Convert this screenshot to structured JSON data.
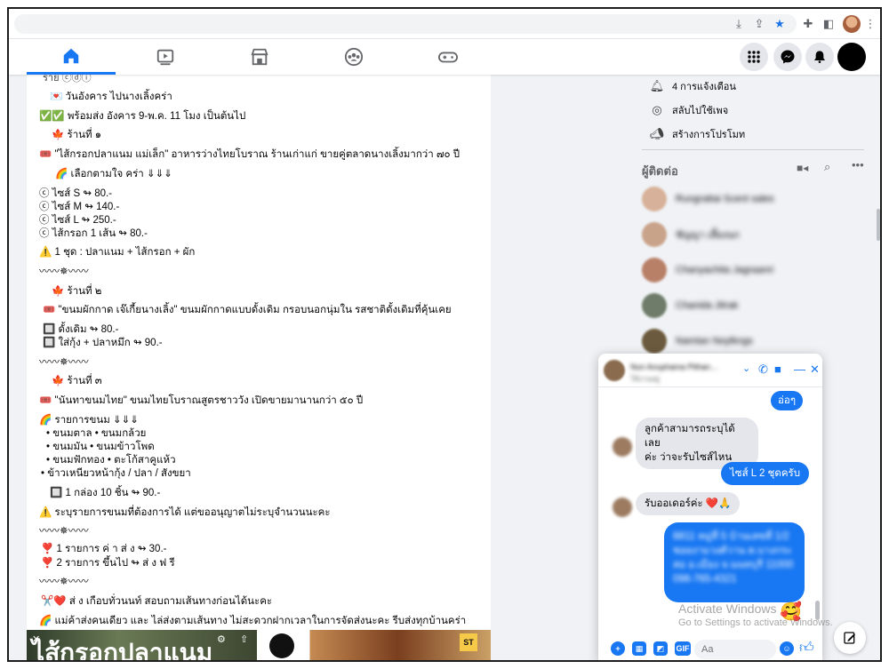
{
  "colors": {
    "accent": "#1877f2",
    "frame": "#1c1c1c",
    "panel_bg": "#f0f2f5"
  },
  "browser": {
    "icons": [
      "download-icon",
      "share-icon",
      "star-icon",
      "extensions-icon",
      "sidepanel-icon",
      "profile-avatar",
      "kebab-menu-icon"
    ]
  },
  "nav": {
    "tabs": [
      "home-icon",
      "watch-icon",
      "marketplace-icon",
      "groups-icon",
      "gaming-icon"
    ],
    "right_icons": [
      "menu-grid-icon",
      "messenger-icon",
      "notifications-icon",
      "account-avatar"
    ]
  },
  "post": {
    "header_partial": "ราย ⓒⓓⓘ",
    "lines": [
      "💌 วันอังคาร ไปนางเลิ้งคร่า",
      "✅✅ พร้อมส่ง อังคาร 9-พ.ค. 11 โมง เป็นต้นไป",
      "🍁 ร้านที่ ๑",
      "🎟️ \"ไส้กรอกปลาแนม แม่เล็ก\" อาหารว่างไทยโบราณ ร้านเก่าแก่ ขายคู่ตลาดนางเลิ้งมากว่า ๗๐ ปี",
      "🌈 เลือกตามใจ คร่า ⇓⇓⇓",
      "ⓒ ไซส์ S ↬ 80.-",
      "ⓒ ไซส์ M ↬ 140.-",
      "ⓒ ไซส์ L ↬ 250.-",
      "ⓒ ไส้กรอก 1 เส้น ↬ 80.-",
      "⚠️ 1 ชุด : ปลาแนม + ไส้กรอก + ผัก",
      "〰〰✵〰〰",
      "🍁 ร้านที่ ๒",
      "🎟️ \"ขนมผักกาด เจ๊เกี้ยนางเลิ้ง\" ขนมผักกาดแบบดั้งเดิม กรอบนอกนุ่มใน รสชาติดั้งเดิมที่คุ้นเคย",
      "🔲 ดั้งเดิม ↬ 80.-",
      "🔲 ใส่กุ้ง + ปลาหมึก ↬ 90.-",
      "〰〰✵〰〰",
      "🍁 ร้านที่ ๓",
      "🎟️ \"นันทาขนมไทย\" ขนมไทยโบราณสูตรชาววัง เปิดขายมานานกว่า ๕๐ ปี",
      "🌈 รายการขนม ⇓⇓⇓",
      "• ขนมตาล          • ขนมกล้วย",
      "• ขนมมัน            • ขนมข้าวโพด",
      "• ขนมฟักทอง      • ตะโก้สาคูแห้ว",
      "• ข้าวเหนียวหน้ากุ้ง / ปลา / สังขยา",
      "🔲 1 กล่อง 10 ชิ้น ↬ 90.-",
      "⚠️ ระบุรายการขนมที่ต้องการได้ แต่ขออนุญาตไม่ระบุจำนวนนะคะ",
      "〰〰✵〰〰",
      "❣️ 1 รายการ ค่ า ส่ ง ↬ 30.-",
      "❣️ 2 รายการ ขึ้นไป  ↬ ส่ ง ฟ รี",
      "〰〰✵〰〰",
      "✂️❤️ ส่ ง เกือบทั่วนนท์ สอบถามเส้นทางก่อนได้นะคะ",
      "🌈 แม่ค้าส่งคนเดียว และ ไล่ส่งตามเส้นทาง ไม่สะดวกฝากเวลาในการจัดส่งนะคะ รีบส่งทุกบ้านคร่า"
    ],
    "media_caption": "ไส้กรอกปลาแนม",
    "media_badge": "ST"
  },
  "right_panel": {
    "shortcuts": [
      {
        "icon": "bell-icon",
        "label": "4 การแจ้งเตือน"
      },
      {
        "icon": "switch-page-icon",
        "label": "สลับไปใช้เพจ"
      },
      {
        "icon": "megaphone-icon",
        "label": "สร้างการโปรโมท"
      }
    ],
    "contacts_title": "ผู้ติดต่อ",
    "contacts": [
      "Rungrattai Scent sales",
      "ชัญญา เลี้ยงนก",
      "Chanyachita Jagraanri",
      "Chanida Jitrak",
      "Namtan Noylkngs"
    ]
  },
  "chat": {
    "name": "Nun Anuphama Pithan…",
    "status": "ใช้งานอยู่",
    "messages": [
      {
        "dir": "out",
        "text": "อ่อๆ"
      },
      {
        "dir": "in",
        "text": "ลูกค้าสามารถระบุได้เลย\nค่ะ ว่าจะรับไซส์ไหน"
      },
      {
        "dir": "out",
        "text": "ไซส์ L 2 ชุดครับ"
      },
      {
        "dir": "in",
        "text": "รับออเดอร์ค่ะ ❤️🙏"
      },
      {
        "dir": "out",
        "text": "8811 หมู่ที่ 5 บ้านเลขที่ 1/2 ซอยงามวงศ์วาน ต.บางกระสอ อ.เมือง จ.นนทบุรี 11000 098-765-4321"
      }
    ],
    "reaction": "🥰",
    "input_placeholder": "Aa",
    "footer_icons": [
      "plus-icon",
      "image-icon",
      "sticker-icon",
      "gif-icon"
    ]
  },
  "watermark": {
    "line1": "Activate Windows",
    "line2": "Go to Settings to activate Windows."
  }
}
